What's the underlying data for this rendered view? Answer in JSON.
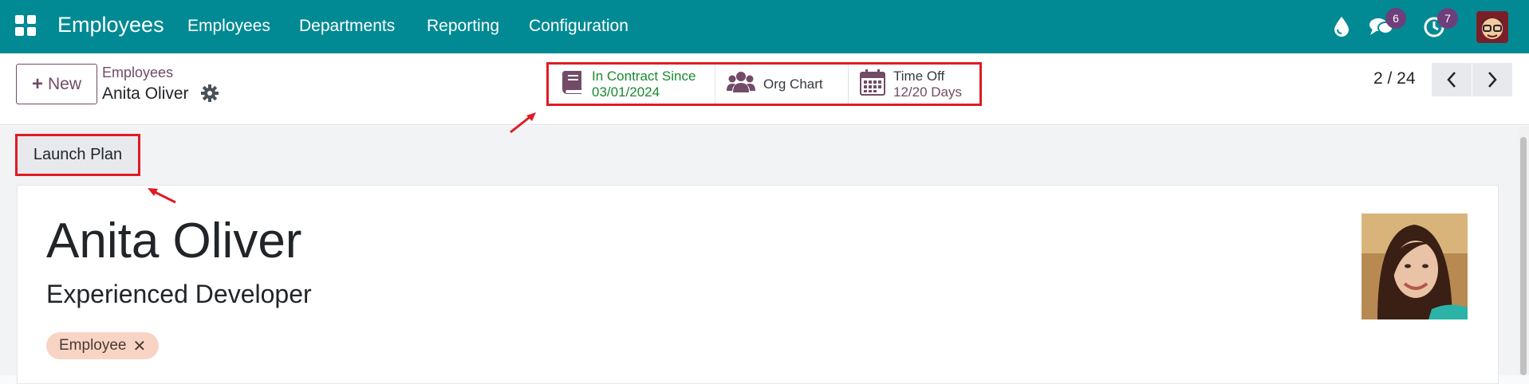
{
  "topbar": {
    "app_title": "Employees",
    "menu": [
      "Employees",
      "Departments",
      "Reporting",
      "Configuration"
    ],
    "activity_badge": "6",
    "clock_badge": "7"
  },
  "breadcrumb": {
    "new_label": "New",
    "parent": "Employees",
    "current": "Anita Oliver"
  },
  "smart_buttons": {
    "contract": {
      "line1": "In Contract Since",
      "line2": "03/01/2024"
    },
    "org_chart": {
      "label": "Org Chart"
    },
    "time_off": {
      "line1": "Time Off",
      "line2": "12/20 Days"
    }
  },
  "pager": {
    "value": "2 / 24"
  },
  "actions": {
    "launch_plan": "Launch Plan"
  },
  "employee": {
    "name": "Anita Oliver",
    "job_title": "Experienced Developer",
    "tags": [
      "Employee"
    ]
  },
  "colors": {
    "topbar": "#018a94",
    "primary": "#714b67",
    "highlight": "#e01b24",
    "contract_green": "#1a8b2e"
  }
}
